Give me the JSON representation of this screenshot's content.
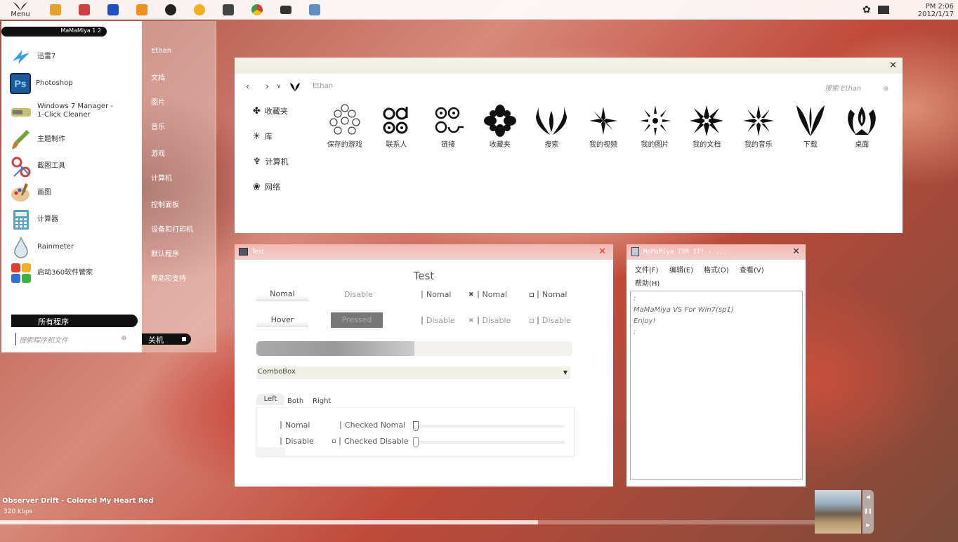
{
  "taskbar": {
    "menu_label": "Menu",
    "pinned": [
      {
        "name": "explorer",
        "color": "#e8a030"
      },
      {
        "name": "notepad-edit",
        "color": "#d04040"
      },
      {
        "name": "ime",
        "color": "#2050c0"
      },
      {
        "name": "player",
        "color": "#f09020"
      },
      {
        "name": "qq",
        "color": "#222222"
      },
      {
        "name": "media",
        "color": "#f0b020"
      },
      {
        "name": "skull",
        "color": "#444444"
      },
      {
        "name": "chrome",
        "color": "#d04030"
      },
      {
        "name": "monitor",
        "color": "#333333"
      },
      {
        "name": "notebook",
        "color": "#6090c0"
      }
    ],
    "clock": {
      "time": "PM 2:06",
      "date": "2012/1/17"
    }
  },
  "start_menu": {
    "username": "MaMaMiya 1 2",
    "programs": [
      {
        "label": "迅雷7",
        "icon": "thunder-icon",
        "color": "#3a9ee0"
      },
      {
        "label": "Photoshop",
        "icon": "photoshop-icon",
        "color": "#1c5c9c",
        "badge": "Ps"
      },
      {
        "label": "Windows 7 Manager -\n1-Click Cleaner",
        "icon": "cleaner-icon",
        "color": "#c8c070"
      },
      {
        "label": "主题制作",
        "icon": "brush-icon",
        "color": "#70a040"
      },
      {
        "label": "截图工具",
        "icon": "scissors-icon",
        "color": "#d04040"
      },
      {
        "label": "画图",
        "icon": "paint-icon",
        "color": "#e0a050"
      },
      {
        "label": "计算器",
        "icon": "calculator-icon",
        "color": "#5aa0c0"
      },
      {
        "label": "Rainmeter",
        "icon": "drop-icon",
        "color": "#8aa0b0"
      },
      {
        "label": "启动360软件管家",
        "icon": "manager-360-icon",
        "color": "#e04030"
      }
    ],
    "all_programs": "所有程序",
    "search_placeholder": "搜索程序和文件",
    "right_links": [
      "Ethan",
      "文档",
      "图片",
      "音乐",
      "游戏",
      "计算机",
      "控制面板",
      "设备和打印机",
      "默认程序",
      "帮助和支持"
    ],
    "shutdown": "关机"
  },
  "explorer": {
    "breadcrumb": "Ethan",
    "search_placeholder": "搜索 Ethan",
    "nav": [
      {
        "label": "收藏夹",
        "icon": "favorites-icon"
      },
      {
        "label": "库",
        "icon": "library-icon"
      },
      {
        "label": "计算机",
        "icon": "computer-icon"
      },
      {
        "label": "网络",
        "icon": "network-icon"
      }
    ],
    "folders": [
      "保存的游戏",
      "联系人",
      "链接",
      "收藏夹",
      "搜索",
      "我的视频",
      "我的图片",
      "我的文档",
      "我的音乐",
      "下载",
      "桌面"
    ]
  },
  "test_window": {
    "title": "Test",
    "heading": "Test",
    "buttons": {
      "normal": "Nomal",
      "disable": "Disable",
      "hover": "Hover",
      "pressed": "Pressed"
    },
    "checks": {
      "normal": "Nomal",
      "disable": "Disable"
    },
    "progress": 0.5,
    "combo": "ComboBox",
    "tabs": [
      "Left",
      "Both",
      "Right"
    ],
    "panel": {
      "normal": "Nomal",
      "disable": "Disable",
      "checked_normal": "Checked Nomal",
      "checked_disable": "Checked Disable"
    }
  },
  "notepad": {
    "title": "MaMaMiya TYR IT! - ...",
    "menu": [
      "文件(F)",
      "编辑(E)",
      "格式(O)",
      "查看(V)",
      "帮助(H)"
    ],
    "text": ":\nMaMaMiya VS For Win7(sp1)\nEnjoy!\n:"
  },
  "music": {
    "title": "Observer Drift - Colored My Heart Red",
    "bitrate": "320 kbps",
    "progress": 0.66
  }
}
